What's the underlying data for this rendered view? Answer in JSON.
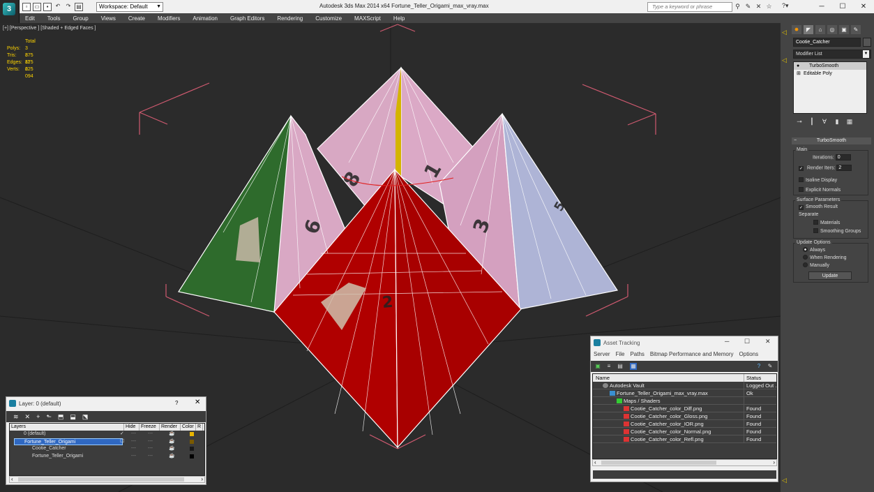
{
  "titlebar": {
    "workspace": "Workspace: Default",
    "app_title": "Autodesk 3ds Max  2014 x64      Fortune_Teller_Origami_max_vray.max",
    "search_placeholder": "Type a keyword or phrase"
  },
  "menu": [
    "Edit",
    "Tools",
    "Group",
    "Views",
    "Create",
    "Modifiers",
    "Animation",
    "Graph Editors",
    "Rendering",
    "Customize",
    "MAXScript",
    "Help"
  ],
  "viewport": {
    "label": "[+] [Perspective ] [Shaded + Edged Faces ]",
    "stats": {
      "header": "Total",
      "polys_label": "Polys:",
      "polys": "3 875",
      "tris_label": "Tris:",
      "tris": "3 875",
      "edges_label": "Edges:",
      "edges": "11 625",
      "verts_label": "Verts:",
      "verts": "2 094"
    },
    "numbers": [
      "8",
      "1",
      "6",
      "3",
      "5",
      "2"
    ],
    "colors": {
      "green": "#2e6b2c",
      "pink": "#d9a8c4",
      "red": "#b00000",
      "blue": "#aeb4d6"
    }
  },
  "command_panel": {
    "object_name": "Cootie_Catcher",
    "modifier_list": "Modifier List",
    "stack": [
      "TurboSmooth",
      "Editable Poly"
    ],
    "rollout_title": "TurboSmooth",
    "main_label": "Main",
    "iterations_label": "Iterations:",
    "iterations": "0",
    "render_iters_label": "Render Iters:",
    "render_iters": "2",
    "isoline": "Isoline Display",
    "explicit_normals": "Explicit Normals",
    "surface_params": "Surface Parameters",
    "smooth_result": "Smooth Result",
    "separate": "Separate",
    "materials": "Materials",
    "smoothing_groups": "Smoothing Groups",
    "update_options": "Update Options",
    "always": "Always",
    "when_rendering": "When Rendering",
    "manually": "Manually",
    "update_btn": "Update"
  },
  "layers": {
    "title": "Layer: 0 (default)",
    "help": "?",
    "columns": [
      "Layers",
      "Hide",
      "Freeze",
      "Render",
      "Color",
      "R"
    ],
    "rows": [
      {
        "name": "0 (default)",
        "color": "#e8b400"
      },
      {
        "name": "Fortune_Teller_Origami",
        "color": "#7a5a00"
      },
      {
        "name": "Cootie_Catcher",
        "color": "#1a1a1a"
      },
      {
        "name": "Fortune_Teller_Origami",
        "color": "#000000"
      }
    ]
  },
  "assets": {
    "title": "Asset Tracking",
    "menu": [
      "Server",
      "File",
      "Paths",
      "Bitmap Performance and Memory",
      "Options"
    ],
    "col_name": "Name",
    "col_status": "Status",
    "rows": [
      {
        "name": "Autodesk Vault",
        "status": "Logged Out ..."
      },
      {
        "name": "Fortune_Teller_Origami_max_vray.max",
        "status": "Ok"
      },
      {
        "name": "Maps / Shaders",
        "status": ""
      },
      {
        "name": "Cootie_Catcher_color_Diff.png",
        "status": "Found"
      },
      {
        "name": "Cootie_Catcher_color_Gloss.png",
        "status": "Found"
      },
      {
        "name": "Cootie_Catcher_color_IOR.png",
        "status": "Found"
      },
      {
        "name": "Cootie_Catcher_color_Normal.png",
        "status": "Found"
      },
      {
        "name": "Cootie_Catcher_color_Refl.png",
        "status": "Found"
      }
    ]
  }
}
